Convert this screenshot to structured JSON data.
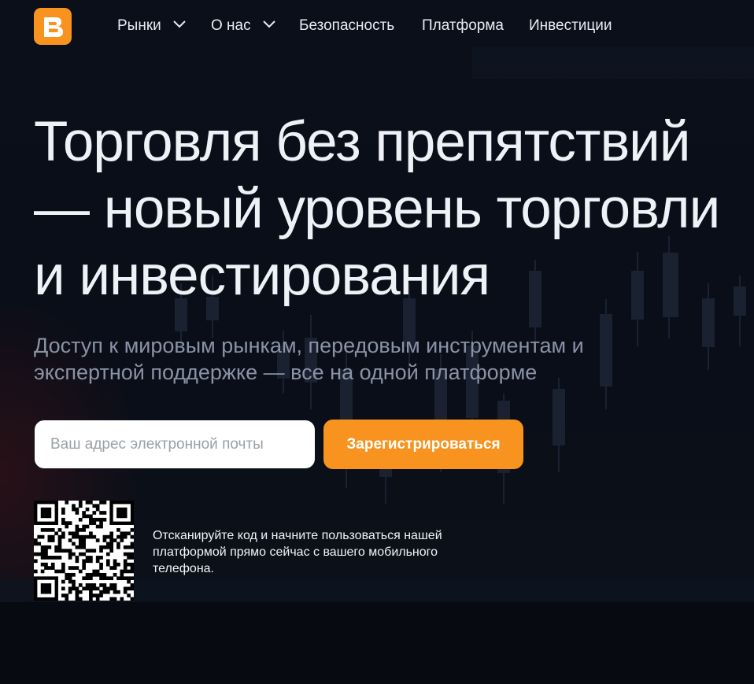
{
  "nav": {
    "logo_icon": "brand-logo-icon",
    "items": [
      {
        "label": "Рынки",
        "has_dropdown": true
      },
      {
        "label": "О нас",
        "has_dropdown": true
      },
      {
        "label": "Безопасность",
        "has_dropdown": false
      },
      {
        "label": "Платформа",
        "has_dropdown": false
      },
      {
        "label": "Инвестиции",
        "has_dropdown": false
      }
    ]
  },
  "hero": {
    "headline_lines": [
      "Торговля без препятствий",
      "— новый уровень торговли",
      "и инвестирования"
    ],
    "subtitle_lines": [
      "Доступ к мировым рынкам, передовым инструментам и",
      "экспертной поддержке — все на одной платформе"
    ]
  },
  "signup": {
    "email_placeholder": "Ваш адрес электронной почты",
    "email_value": "",
    "register_label": "Зарегистрироваться"
  },
  "qr": {
    "icon": "qr-code-icon",
    "text_lines": [
      "Отсканируйте код и начните пользоваться нашей",
      "платформой прямо сейчас с вашего мобильного",
      "телефона."
    ]
  },
  "colors": {
    "accent": "#f7931e",
    "background": "#0b0f1a",
    "headline": "#eef1f6",
    "subtitle": "#8a93a6"
  }
}
